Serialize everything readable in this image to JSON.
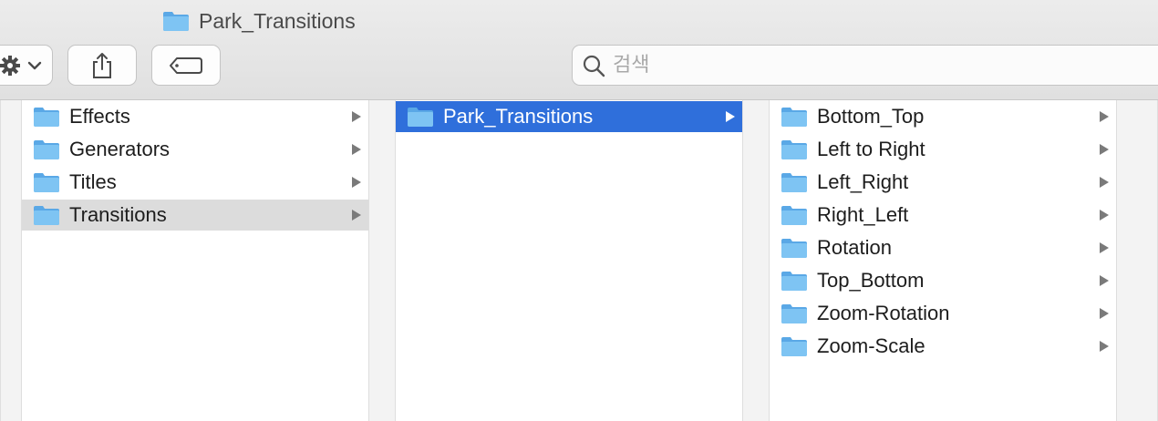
{
  "window": {
    "title": "Park_Transitions",
    "title_icon": "folder-icon"
  },
  "toolbar": {
    "action_icon": "gear-icon",
    "share_icon": "share-icon",
    "tag_icon": "tag-icon",
    "search_placeholder": "검색",
    "search_value": ""
  },
  "colors": {
    "selection": "#2f6fdb",
    "folder": "#6ebaf0",
    "gray_selection": "#dcdcdc"
  },
  "columns": [
    {
      "items": [
        {
          "label": "Effects",
          "state": "none",
          "has_children": true
        },
        {
          "label": "Generators",
          "state": "none",
          "has_children": true
        },
        {
          "label": "Titles",
          "state": "none",
          "has_children": true
        },
        {
          "label": "Transitions",
          "state": "path",
          "has_children": true
        }
      ]
    },
    {
      "items": [
        {
          "label": "Park_Transitions",
          "state": "selected",
          "has_children": true
        }
      ]
    },
    {
      "items": [
        {
          "label": "Bottom_Top",
          "state": "none",
          "has_children": true
        },
        {
          "label": "Left to Right",
          "state": "none",
          "has_children": true
        },
        {
          "label": "Left_Right",
          "state": "none",
          "has_children": true
        },
        {
          "label": "Right_Left",
          "state": "none",
          "has_children": true
        },
        {
          "label": "Rotation",
          "state": "none",
          "has_children": true
        },
        {
          "label": "Top_Bottom",
          "state": "none",
          "has_children": true
        },
        {
          "label": "Zoom-Rotation",
          "state": "none",
          "has_children": true
        },
        {
          "label": "Zoom-Scale",
          "state": "none",
          "has_children": true
        }
      ]
    }
  ]
}
